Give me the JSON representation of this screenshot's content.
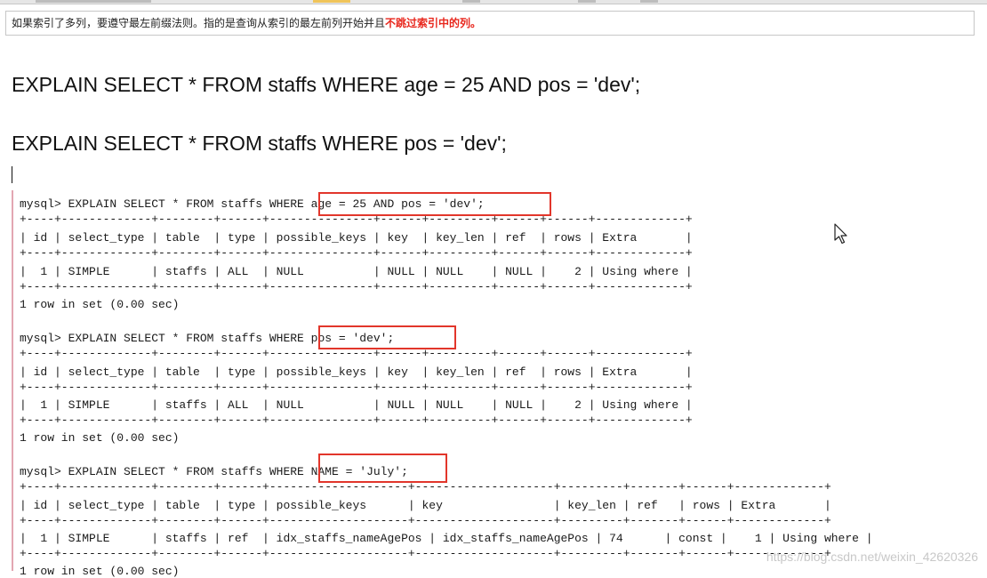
{
  "note": {
    "text": "如果索引了多列，要遵守最左前缀法则。指的是查询从索引的最左前列开始并且",
    "emphasis": "不跳过索引中的列。"
  },
  "statements": [
    "EXPLAIN SELECT * FROM staffs WHERE age = 25 AND pos = 'dev';",
    "EXPLAIN SELECT * FROM staffs WHERE pos = 'dev';"
  ],
  "console": {
    "q1": {
      "prompt": "mysql> EXPLAIN SELECT * FROM staffs WHERE age = 25 AND pos = 'dev';",
      "border": "+----+-------------+--------+------+---------------+------+---------+------+------+-------------+",
      "header": "| id | select_type | table  | type | possible_keys | key  | key_len | ref  | rows | Extra       |",
      "row": "|  1 | SIMPLE      | staffs | ALL  | NULL          | NULL | NULL    | NULL |    2 | Using where |",
      "footer": "1 row in set (0.00 sec)"
    },
    "q2": {
      "prompt": "mysql> EXPLAIN SELECT * FROM staffs WHERE pos = 'dev';",
      "border": "+----+-------------+--------+------+---------------+------+---------+------+------+-------------+",
      "header": "| id | select_type | table  | type | possible_keys | key  | key_len | ref  | rows | Extra       |",
      "row": "|  1 | SIMPLE      | staffs | ALL  | NULL          | NULL | NULL    | NULL |    2 | Using where |",
      "footer": "1 row in set (0.00 sec)"
    },
    "q3": {
      "prompt": "mysql> EXPLAIN SELECT * FROM staffs WHERE NAME = 'July';",
      "border": "+----+-------------+--------+------+--------------------+--------------------+---------+-------+------+-------------+",
      "header": "| id | select_type | table  | type | possible_keys      | key                | key_len | ref   | rows | Extra       |",
      "row": "|  1 | SIMPLE      | staffs | ref  | idx_staffs_nameAgePos | idx_staffs_nameAgePos | 74      | const |    1 | Using where |",
      "footer": "1 row in set (0.00 sec)"
    }
  },
  "watermark": "https://blog.csdn.net/weixin_42620326",
  "colors": {
    "highlight": "#e2362b",
    "emphasis": "#e8281e",
    "console_bar": "#e3a6b2"
  }
}
